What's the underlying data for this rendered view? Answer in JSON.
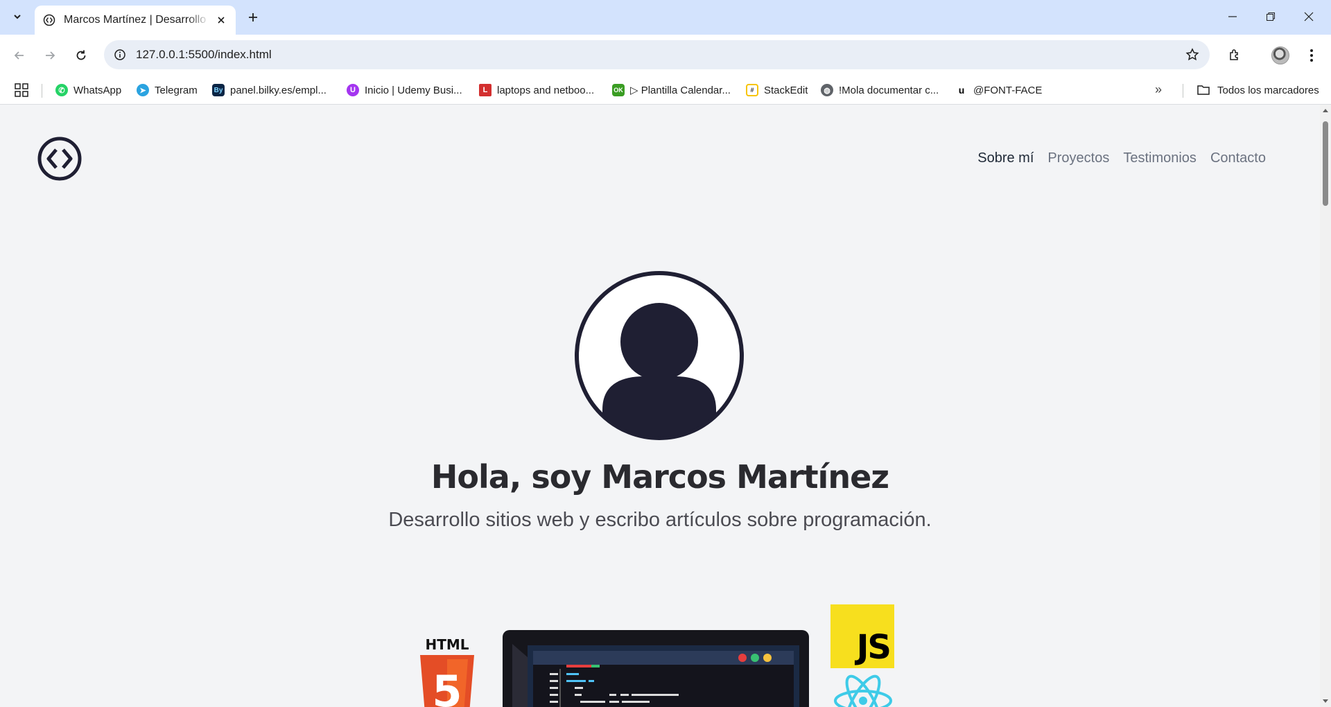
{
  "browser": {
    "tab": {
      "title": "Marcos Martínez | Desarrollo Web"
    },
    "address": {
      "url": "127.0.0.1:5500/index.html"
    },
    "bookmarks": [
      {
        "label": "WhatsApp",
        "icon": "whatsapp-icon",
        "color": "#25d366"
      },
      {
        "label": "Telegram",
        "icon": "telegram-icon",
        "color": "#2aa3e0"
      },
      {
        "label": "panel.bilky.es/empl...",
        "icon": "bilky-icon",
        "color": "#0b2545"
      },
      {
        "label": "Inicio | Udemy Busi...",
        "icon": "udemy-icon",
        "color": "#a435f0"
      },
      {
        "label": "laptops and netboo...",
        "icon": "l-icon",
        "color": "#d32f2f"
      },
      {
        "label": "▷ Plantilla Calendar...",
        "icon": "ok-icon",
        "color": "#3a9d23"
      },
      {
        "label": "StackEdit",
        "icon": "stackedit-icon",
        "color": "#f7c400"
      },
      {
        "label": "!Mola documentar c...",
        "icon": "globe-icon",
        "color": "#5f6368"
      },
      {
        "label": "@FONT-FACE",
        "icon": "u-icon",
        "color": "#000000"
      }
    ],
    "all_bookmarks": "Todos los marcadores"
  },
  "site": {
    "nav": [
      {
        "label": "Sobre mí",
        "active": true
      },
      {
        "label": "Proyectos",
        "active": false
      },
      {
        "label": "Testimonios",
        "active": false
      },
      {
        "label": "Contacto",
        "active": false
      }
    ],
    "hero": {
      "title": "Hola, soy Marcos Martínez",
      "subtitle": "Desarrollo sitios web y escribo artículos sobre programación."
    },
    "tech": {
      "html_label": "HTML",
      "html_number": "5",
      "js_label": "JS"
    },
    "colors": {
      "accent": "#1f1f33",
      "background": "#f3f4f6"
    }
  }
}
